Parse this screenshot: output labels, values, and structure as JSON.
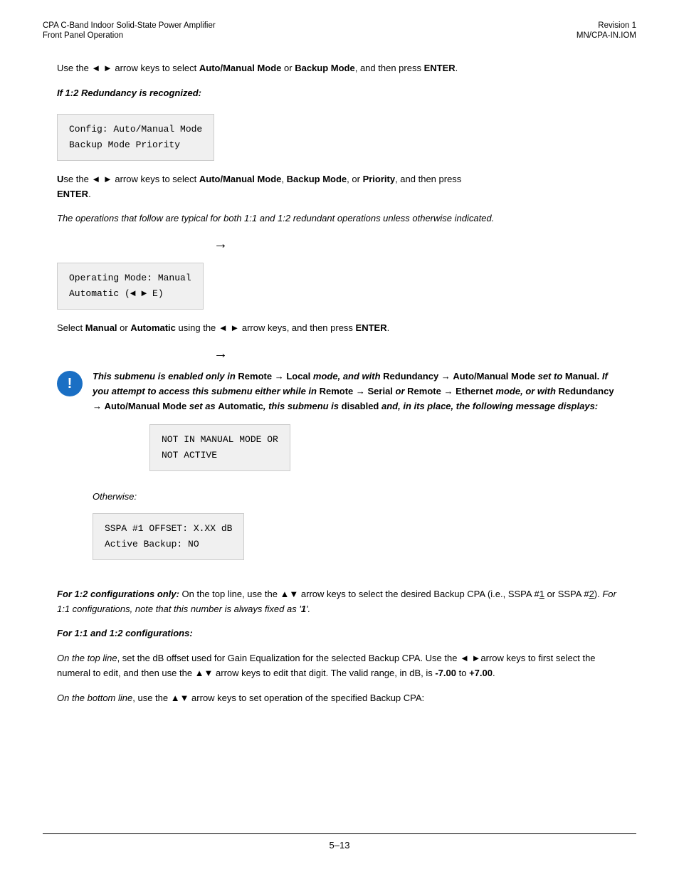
{
  "header": {
    "left_line1": "CPA C-Band Indoor Solid-State Power Amplifier",
    "left_line2": "Front Panel Operation",
    "right_line1": "Revision 1",
    "right_line2": "MN/CPA-IN.IOM"
  },
  "content": {
    "para1": "Use the ◄  ►  arrow keys to select ",
    "para1_bold1": "Auto/Manual Mode",
    "para1_mid": " or ",
    "para1_bold2": "Backup Mode",
    "para1_end": ", and then press ",
    "para1_bold3": "ENTER",
    "para1_period": ".",
    "if_label": "If 1:2 Redundancy is recognized:",
    "code_box1_line1": "Config: Auto/Manual Mode",
    "code_box1_line2": "Backup Mode      Priority",
    "para2_u": "U",
    "para2_rest": "se the ◄  ►  arrow keys to select ",
    "para2_bold1": "Auto/Manual Mode",
    "para2_comma1": ", ",
    "para2_bold2": "Backup Mode",
    "para2_comma2": ", or ",
    "para2_bold3": "Priority",
    "para2_end": ", and then press",
    "para2_bold4": "ENTER",
    "para2_period": ".",
    "italic_para": "The operations that follow are typical for both 1:1 and 1:2 redundant operations unless otherwise indicated.",
    "arrow1": "→",
    "code_box2_line1": "Operating Mode: Manual",
    "code_box2_line2": "Automatic        (◄ ► E)",
    "para3": "Select ",
    "para3_bold1": "Manual",
    "para3_or": " or ",
    "para3_bold2": "Automatic",
    "para3_rest": " using the ◄  ►   arrow keys, and then press ",
    "para3_bold3": "ENTER",
    "para3_period": ".",
    "arrow2": "→",
    "notice_italic1": "This submenu is enabled only in ",
    "notice_bold1": "Remote",
    "notice_arrow1": " → ",
    "notice_bold2": "Local",
    "notice_italic2": " mode, and with ",
    "notice_bold3": "Redundancy",
    "notice_arrow2": " →",
    "notice_line2_bold1": "Auto/Manual Mode ",
    "notice_italic3": "set to ",
    "notice_bold4": "Manual.",
    "notice_italic4": " If you attempt to access this submenu either while in ",
    "notice_bold5": "Remote",
    "notice_arrow3": " → ",
    "notice_bold6": "Serial",
    "notice_italic5": " or ",
    "notice_bold7": "Remote",
    "notice_arrow4": " → ",
    "notice_bold8": "Ethernet",
    "notice_italic6": " mode, or with ",
    "notice_bold9": "Redundancy",
    "notice_arrow5": " →",
    "notice_line3_bold1": "Auto/Manual Mode ",
    "notice_italic7": "set as ",
    "notice_bold10": "Automatic",
    "notice_italic8": ", this submenu is ",
    "notice_bold11": "disabled",
    "notice_italic9": " and, in its place, the following message displays:",
    "code_box3_line1": "NOT IN MANUAL MODE OR",
    "code_box3_line2": "NOT ACTIVE",
    "otherwise_label": "Otherwise:",
    "code_box4_line1": "SSPA #1 OFFSET: X.XX dB",
    "code_box4_line2": "Active Backup: NO",
    "para4_bold": "For 1:2 configurations only:",
    "para4_rest1": " On the top line, use the ▲▼ arrow keys to select the desired Backup CPA (i.e., SSPA #",
    "para4_u1": "1",
    "para4_mid": " or SSPA #",
    "para4_u2": "2",
    "para4_rest2": "). ",
    "para4_italic": "For 1:1 configurations, note that this number is always fixed as '",
    "para4_italic_bold": "1",
    "para4_italic_end": "'.",
    "for11_label": "For 1:1 and 1:2 configurations:",
    "para5_italic1": "On the top line",
    "para5_rest1": ", set the dB offset used for Gain Equalization for the selected Backup CPA. Use the ◄ ►arrow keys to first select the numeral to edit, and then use the ▲▼ arrow keys to edit that digit. The valid range, in dB, is ",
    "para5_bold1": "-7.00",
    "para5_to": " to ",
    "para5_bold2": "+7.00",
    "para5_period": ".",
    "para6_italic1": "On the bottom line",
    "para6_rest": ", use the ▲▼ arrow keys to set operation of the specified Backup CPA:",
    "footer_page": "5–13"
  }
}
